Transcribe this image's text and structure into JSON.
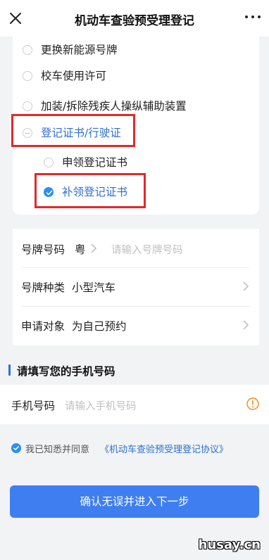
{
  "header": {
    "title": "机动车查验预受理登记",
    "close_icon": "close-icon",
    "more_icon": "more-icon"
  },
  "options": [
    {
      "label": "更换新能源号牌",
      "state": "unchecked"
    },
    {
      "label": "校车使用许可",
      "state": "unchecked"
    },
    {
      "label": "加装/拆除残疾人操纵辅助装置",
      "state": "unchecked"
    },
    {
      "label": "登记证书/行驶证",
      "state": "group-expanded"
    },
    {
      "label": "申领登记证书",
      "state": "unchecked"
    },
    {
      "label": "补领登记证书",
      "state": "checked"
    }
  ],
  "form": {
    "plate_number_label": "号牌号码",
    "plate_province": "粤",
    "plate_number_placeholder": "请输入号牌号码",
    "plate_type_label": "号牌种类",
    "plate_type_value": "小型汽车",
    "applicant_label": "申请对象",
    "applicant_value": "为自己预约"
  },
  "phone_section": {
    "heading": "请填写您的手机号码",
    "phone_label": "手机号码",
    "phone_placeholder": "请输入手机号码",
    "warning_icon": "warning-icon"
  },
  "agreement": {
    "checked": true,
    "text": "我已知悉并同意",
    "link": "《机动车查验预受理登记协议》"
  },
  "submit_label": "确认无误并进入下一步",
  "watermark": "husay.cn",
  "colors": {
    "accent": "#3f7ef0",
    "link": "#2f6fcf",
    "highlight": "#e02a2a",
    "warning": "#f08a1c"
  }
}
